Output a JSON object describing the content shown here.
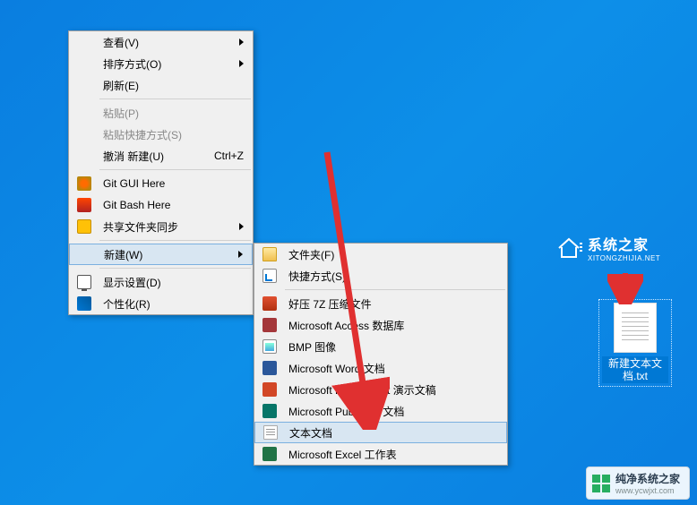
{
  "main_menu": {
    "sections": [
      {
        "items": [
          {
            "label": "查看(V)",
            "has_submenu": true,
            "icon": null,
            "name": "menu-view"
          },
          {
            "label": "排序方式(O)",
            "has_submenu": true,
            "icon": null,
            "name": "menu-sort"
          },
          {
            "label": "刷新(E)",
            "has_submenu": false,
            "icon": null,
            "name": "menu-refresh"
          }
        ]
      },
      {
        "items": [
          {
            "label": "粘贴(P)",
            "has_submenu": false,
            "disabled": true,
            "icon": null,
            "name": "menu-paste"
          },
          {
            "label": "粘贴快捷方式(S)",
            "has_submenu": false,
            "disabled": true,
            "icon": null,
            "name": "menu-paste-shortcut"
          },
          {
            "label": "撤消 新建(U)",
            "shortcut": "Ctrl+Z",
            "icon": null,
            "name": "menu-undo-new"
          }
        ]
      },
      {
        "items": [
          {
            "label": "Git GUI Here",
            "icon": "ic-git-gui",
            "name": "menu-git-gui"
          },
          {
            "label": "Git Bash Here",
            "icon": "ic-git-bash",
            "name": "menu-git-bash"
          },
          {
            "label": "共享文件夹同步",
            "has_submenu": true,
            "icon": "ic-share",
            "name": "menu-share-sync"
          }
        ]
      },
      {
        "items": [
          {
            "label": "新建(W)",
            "has_submenu": true,
            "highlighted": true,
            "icon": null,
            "name": "menu-new"
          }
        ]
      },
      {
        "items": [
          {
            "label": "显示设置(D)",
            "icon": "ic-display",
            "name": "menu-display-settings"
          },
          {
            "label": "个性化(R)",
            "icon": "ic-personalize",
            "name": "menu-personalize"
          }
        ]
      }
    ]
  },
  "sub_menu": {
    "sections": [
      {
        "items": [
          {
            "label": "文件夹(F)",
            "icon": "ic-folder",
            "name": "submenu-folder"
          },
          {
            "label": "快捷方式(S)",
            "icon": "ic-shortcut",
            "name": "submenu-shortcut"
          }
        ]
      },
      {
        "items": [
          {
            "label": "好压 7Z 压缩文件",
            "icon": "ic-7z",
            "name": "submenu-7z"
          },
          {
            "label": "Microsoft Access 数据库",
            "icon": "ic-access",
            "name": "submenu-access"
          },
          {
            "label": "BMP 图像",
            "icon": "ic-bmp",
            "name": "submenu-bmp"
          },
          {
            "label": "Microsoft Word 文档",
            "icon": "ic-word",
            "name": "submenu-word"
          },
          {
            "label": "Microsoft PowerPoint 演示文稿",
            "icon": "ic-ppt",
            "name": "submenu-powerpoint"
          },
          {
            "label": "Microsoft Publisher 文档",
            "icon": "ic-pub",
            "name": "submenu-publisher"
          },
          {
            "label": "文本文档",
            "icon": "ic-txt",
            "highlighted": true,
            "name": "submenu-text-document"
          },
          {
            "label": "Microsoft Excel 工作表",
            "icon": "ic-excel",
            "name": "submenu-excel"
          }
        ]
      }
    ]
  },
  "desktop_file": {
    "name": "新建文本文档.txt"
  },
  "logo": {
    "title_cn": "系统之家",
    "title_en": "XITONGZHIJIA.NET"
  },
  "watermark": {
    "title_cn": "纯净系统之家",
    "title_en": "www.ycwjxt.com"
  }
}
